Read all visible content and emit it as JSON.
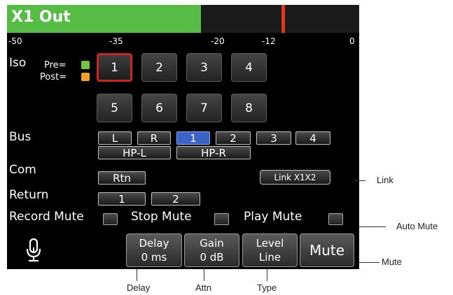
{
  "meter": {
    "title": "X1 Out",
    "scale": [
      "-50",
      "-35",
      "-20",
      "-12",
      "0"
    ],
    "fill_fraction": 0.55,
    "peak_fraction": 0.78,
    "fill_color": "#56bc46",
    "peak_color": "#e0361e"
  },
  "iso": {
    "label": "Iso",
    "pre_label": "Pre=",
    "post_label": "Post=",
    "pre_color": "#76c442",
    "post_color": "#f0a030",
    "buttons": [
      "1",
      "2",
      "3",
      "4",
      "5",
      "6",
      "7",
      "8"
    ],
    "selected": "1"
  },
  "bus": {
    "label": "Bus",
    "buttons": [
      "L",
      "R",
      "1",
      "2",
      "3",
      "4"
    ],
    "hp_buttons": [
      "HP-L",
      "HP-R"
    ],
    "active": "1",
    "active_color": "#3b62c6"
  },
  "com": {
    "label": "Com",
    "rtn": "Rtn",
    "link_button": "Link X1X2"
  },
  "return": {
    "label": "Return",
    "buttons": [
      "1",
      "2"
    ]
  },
  "mute_row": {
    "record": "Record Mute",
    "stop": "Stop Mute",
    "play": "Play Mute"
  },
  "bottom": {
    "mic_icon": "microphone-icon",
    "delay": {
      "label": "Delay",
      "value": "0 ms"
    },
    "gain": {
      "label": "Gain",
      "value": "0 dB"
    },
    "level": {
      "label": "Level",
      "value": "Line"
    },
    "mute": "Mute"
  },
  "callouts": {
    "link": "Link",
    "auto_mute": "Auto Mute",
    "mute": "Mute",
    "delay": "Delay",
    "attn": "Attn",
    "type": "Type"
  }
}
